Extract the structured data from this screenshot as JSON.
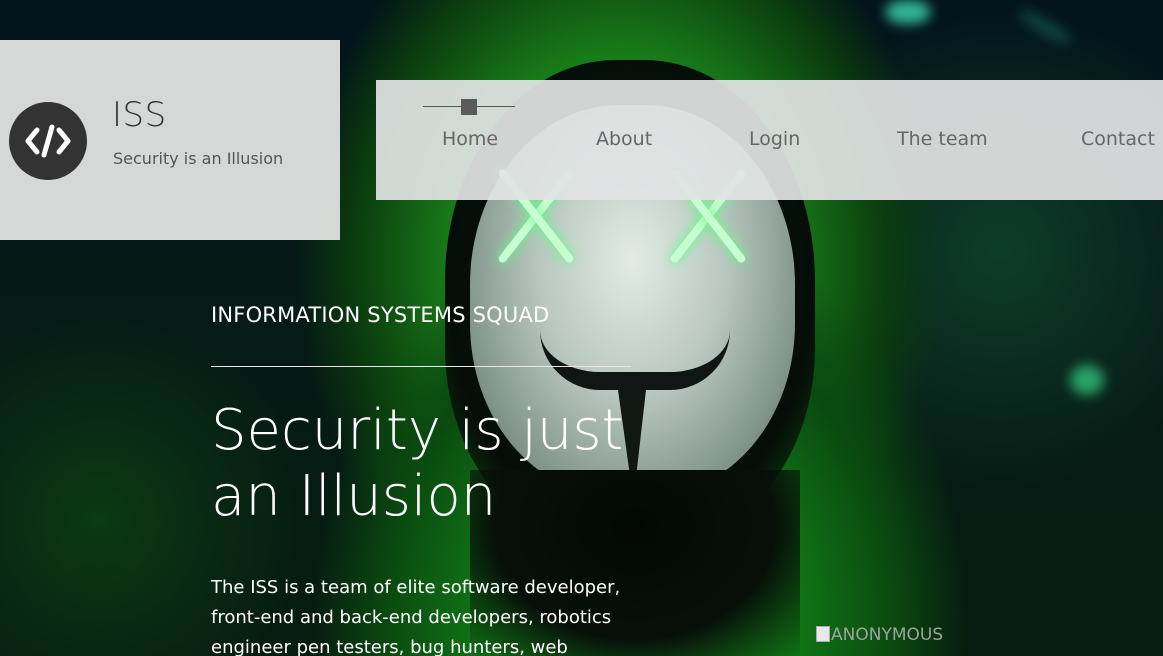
{
  "logo": {
    "title": "ISS",
    "subtitle": "Security is an Illusion",
    "icon": "code-icon"
  },
  "nav": {
    "items": [
      {
        "label": "Home"
      },
      {
        "label": "About"
      },
      {
        "label": "Login"
      },
      {
        "label": "The team"
      },
      {
        "label": "Contact"
      }
    ]
  },
  "hero": {
    "eyebrow": "INFORMATION SYSTEMS SQUAD",
    "headline": "Security is just an Illusion",
    "body": "The ISS is a team of elite software developer, front-end and back-end developers, robotics engineer pen testers, bug hunters, web"
  },
  "image": {
    "alt": "ANONYMOUS"
  },
  "colors": {
    "panel": "#e2e2e2",
    "badge": "#333333",
    "accent_green": "#1f8f22"
  }
}
